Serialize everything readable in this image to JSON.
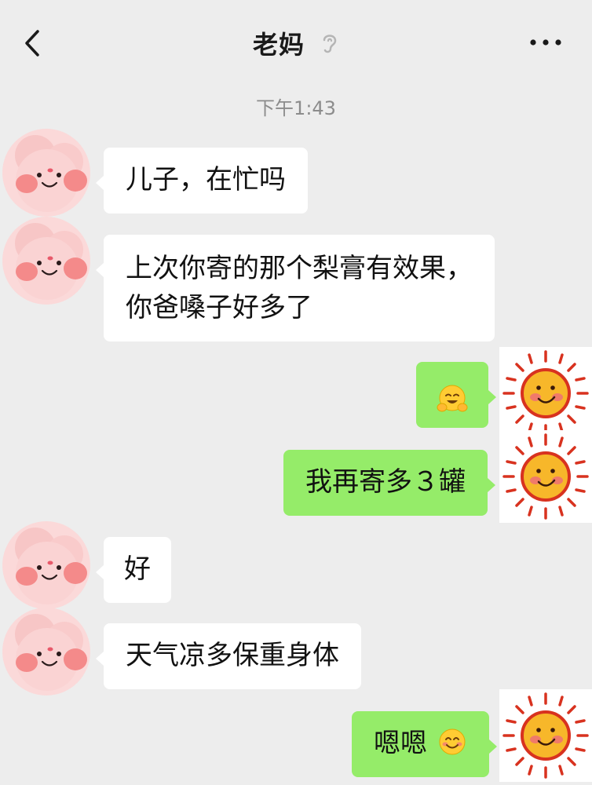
{
  "header": {
    "title": "老妈",
    "back_icon": "chevron-left-icon",
    "ear_icon": "ear-icon",
    "more_icon": "more-dots-icon"
  },
  "timestamp": "下午1:43",
  "messages": [
    {
      "from": "contact",
      "text": "儿子，在忙吗"
    },
    {
      "from": "contact",
      "text": "上次你寄的那个梨膏有效果，\n你爸嗓子好多了"
    },
    {
      "from": "me",
      "text": "",
      "emoji": "hugging-face-emoji"
    },
    {
      "from": "me",
      "text": "我再寄多３罐"
    },
    {
      "from": "contact",
      "text": "好"
    },
    {
      "from": "contact",
      "text": "天气凉多保重身体"
    },
    {
      "from": "me",
      "text": "嗯嗯",
      "emoji": "smiling-face-emoji"
    }
  ],
  "colors": {
    "background": "#ededed",
    "incoming_bubble": "#ffffff",
    "outgoing_bubble": "#95ec69",
    "timestamp": "#8c8c8c"
  }
}
